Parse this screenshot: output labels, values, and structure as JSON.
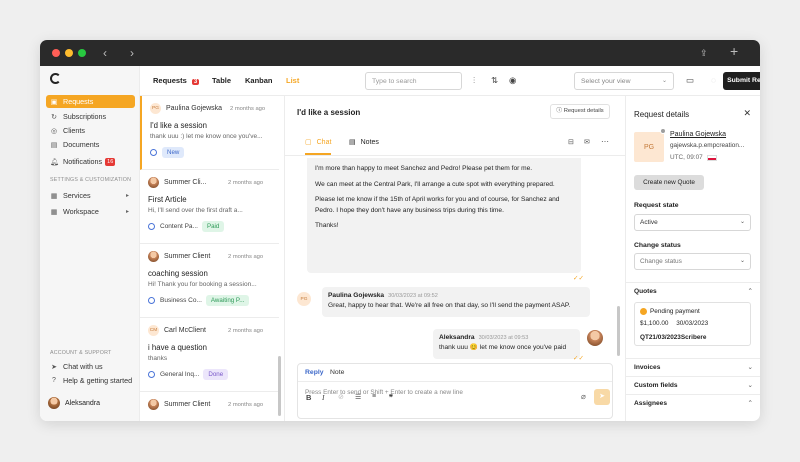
{
  "colors": {
    "accent": "#f5a623",
    "danger": "#e53935",
    "dark": "#1f1f1f",
    "status_blue": "#4a74d8"
  },
  "sidebar": {
    "nav": [
      {
        "label": "Requests",
        "icon": "inbox-icon",
        "active": true
      },
      {
        "label": "Subscriptions",
        "icon": "refresh-icon"
      },
      {
        "label": "Clients",
        "icon": "user-icon"
      },
      {
        "label": "Documents",
        "icon": "document-icon"
      },
      {
        "label": "Notifications",
        "icon": "bell-icon",
        "badge": "16"
      }
    ],
    "settings_header": "SETTINGS & CUSTOMIZATION",
    "settings": [
      {
        "label": "Services",
        "icon": "grid-icon"
      },
      {
        "label": "Workspace",
        "icon": "workspace-icon"
      }
    ],
    "account_header": "ACCOUNT & SUPPORT",
    "account": [
      {
        "label": "Chat with us",
        "icon": "send-icon"
      },
      {
        "label": "Help & getting started",
        "icon": "help-icon"
      }
    ],
    "user": "Aleksandra"
  },
  "topbar": {
    "tabs": {
      "requests": "Requests",
      "requests_count": "3",
      "table": "Table",
      "kanban": "Kanban",
      "list": "List"
    },
    "search_placeholder": "Type to search",
    "view_placeholder": "Select your view",
    "submit": "Submit Request"
  },
  "list": [
    {
      "name": "Paulina Gojewska",
      "initials": "PG",
      "time": "2 months ago",
      "title": "I'd like a session",
      "preview": "thank uuu :) let me know once you've...",
      "service": "",
      "status": "New",
      "status_color": "#dfe9fb",
      "status_text": "#3d68c9"
    },
    {
      "name": "Summer Cli...",
      "initials": "",
      "time": "2 months ago",
      "title": "First Article",
      "preview": "Hi, I'll send over the first draft a...",
      "service": "Content Pa...",
      "status": "Paid",
      "status_color": "#dff5e7",
      "status_text": "#2e9a58"
    },
    {
      "name": "Summer Client",
      "initials": "",
      "time": "2 months ago",
      "title": "coaching session",
      "preview": "Hi! Thank you for booking a session...",
      "service": "Business Co...",
      "status": "Awaiting P...",
      "status_color": "#dff5e7",
      "status_text": "#2e9a58"
    },
    {
      "name": "Carl McClient",
      "initials": "CM",
      "time": "2 months ago",
      "title": "i have a question",
      "preview": "thanks",
      "service": "General Inq...",
      "status": "Done",
      "status_color": "#ece6fb",
      "status_text": "#7957c9"
    },
    {
      "name": "Summer Client",
      "initials": "",
      "time": "2 months ago",
      "title": "",
      "preview": "",
      "service": "",
      "status": "",
      "status_color": "",
      "status_text": ""
    }
  ],
  "chat": {
    "title": "I'd like a session",
    "request_details_btn": "Request details",
    "tab_chat": "Chat",
    "tab_notes": "Notes",
    "bubble1": [
      "I'm more than happy to meet Sanchez and Pedro! Please pet them for me.",
      "We can meet at the Central Park, I'll arrange a cute spot with everything prepared.",
      "Please let me know if the 15th of April works for you and of course, for Sanchez and Pedro. I hope they don't have any business trips during this time.",
      "Thanks!"
    ],
    "msg2": {
      "initials": "PG",
      "name": "Paulina Gojewska",
      "time": "30/03/2023 at 09:52",
      "text": "Great, happy to hear that. We're all free on that day, so I'll send the payment ASAP."
    },
    "msg3": {
      "name": "Aleksandra",
      "time": "30/03/2023 at 09:53",
      "text": "thank uuu 😊 let me know once you've paid"
    },
    "composer": {
      "reply": "Reply",
      "note": "Note",
      "placeholder": "Press Enter to send or Shift + Enter to create a new line"
    }
  },
  "details": {
    "title": "Request details",
    "client_initials": "PG",
    "client_name": "Paulina Gojewska",
    "client_email": "gajewska.p.empcreation...",
    "client_time": "UTC, 09:07",
    "create_quote": "Create new Quote",
    "request_state_label": "Request state",
    "request_state": "Active",
    "change_status_label": "Change status",
    "change_status_placeholder": "Change status",
    "quotes_label": "Quotes",
    "quote_status": "Pending payment",
    "quote_amount": "$1,100.00",
    "quote_date": "30/03/2023",
    "quote_id": "QT21/03/2023Scribere",
    "invoices": "Invoices",
    "custom_fields": "Custom fields",
    "assignees": "Assignees"
  }
}
